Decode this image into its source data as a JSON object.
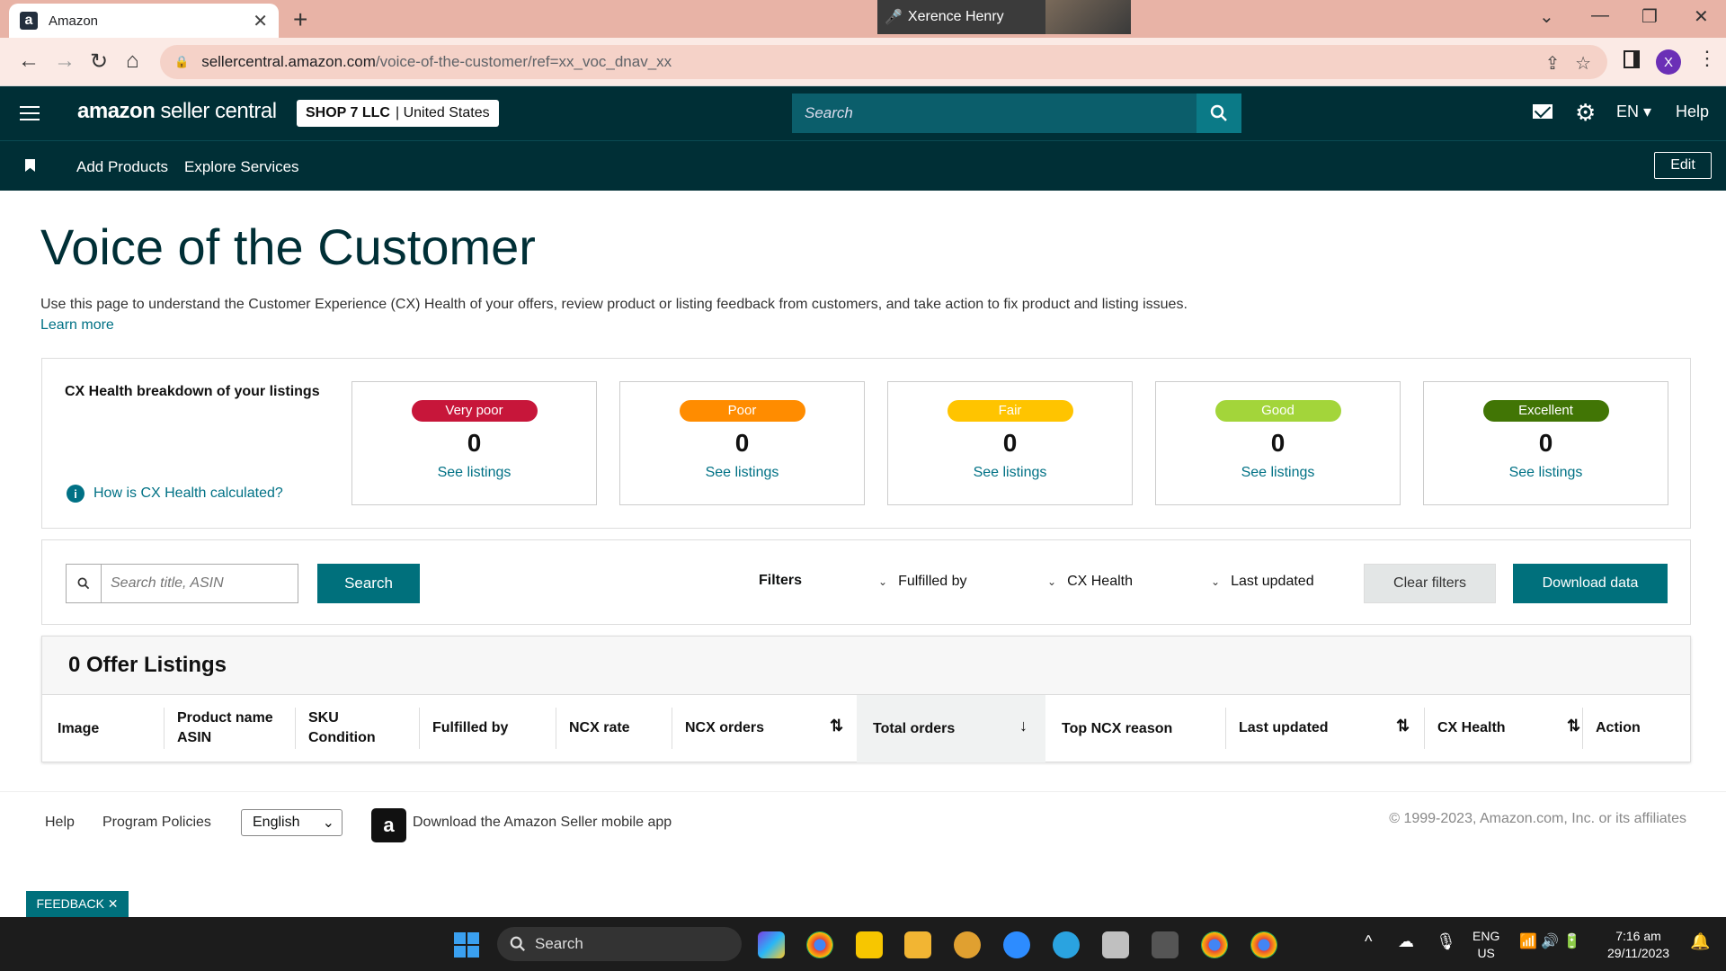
{
  "browser": {
    "tab_title": "Amazon",
    "url_host": "sellercentral.amazon.com",
    "url_path": "/voice-of-the-customer/ref=xx_voc_dnav_xx",
    "profile_initial": "X",
    "zoom_participant": "Xerence Henry"
  },
  "header": {
    "logo_main": "amazon",
    "logo_sub": "seller central",
    "store_name": "SHOP 7 LLC",
    "store_region": "United States",
    "search_placeholder": "Search",
    "language": "EN",
    "help": "Help"
  },
  "subnav": {
    "add_products": "Add Products",
    "explore_services": "Explore Services",
    "edit": "Edit"
  },
  "page": {
    "title": "Voice of the Customer",
    "intro": "Use this page to understand the Customer Experience (CX) Health of your offers, review product or listing feedback from customers, and take action to fix product and listing issues.",
    "learn_more": "Learn more"
  },
  "cx": {
    "heading": "CX Health breakdown of your listings",
    "help_link": "How is CX Health calculated?",
    "cards": [
      {
        "label": "Very poor",
        "count": "0",
        "link": "See listings",
        "color": "#c7163a"
      },
      {
        "label": "Poor",
        "count": "0",
        "link": "See listings",
        "color": "#ff8c00"
      },
      {
        "label": "Fair",
        "count": "0",
        "link": "See listings",
        "color": "#ffc400"
      },
      {
        "label": "Good",
        "count": "0",
        "link": "See listings",
        "color": "#a3d53a"
      },
      {
        "label": "Excellent",
        "count": "0",
        "link": "See listings",
        "color": "#417505"
      }
    ]
  },
  "filters": {
    "search_placeholder": "Search title, ASIN",
    "search_button": "Search",
    "label": "Filters",
    "fulfilled_by": "Fulfilled by",
    "cx_health": "CX Health",
    "last_updated": "Last updated",
    "clear": "Clear filters",
    "download": "Download data"
  },
  "table": {
    "title": "0 Offer Listings",
    "columns": {
      "image": "Image",
      "product_name": "Product name",
      "asin": "ASIN",
      "sku": "SKU",
      "condition": "Condition",
      "fulfilled_by": "Fulfilled by",
      "ncx_rate": "NCX rate",
      "ncx_orders": "NCX orders",
      "total_orders": "Total orders",
      "top_ncx_reason": "Top NCX reason",
      "last_updated": "Last updated",
      "cx_health": "CX Health",
      "action": "Action"
    }
  },
  "footer": {
    "help": "Help",
    "program_policies": "Program Policies",
    "language": "English",
    "app_link": "Download the Amazon Seller mobile app",
    "copyright": "© 1999-2023, Amazon.com, Inc. or its affiliates",
    "feedback": "FEEDBACK ✕"
  },
  "taskbar": {
    "search": "Search",
    "lang_top": "ENG",
    "lang_bottom": "US",
    "time": "7:16 am",
    "date": "29/11/2023"
  }
}
